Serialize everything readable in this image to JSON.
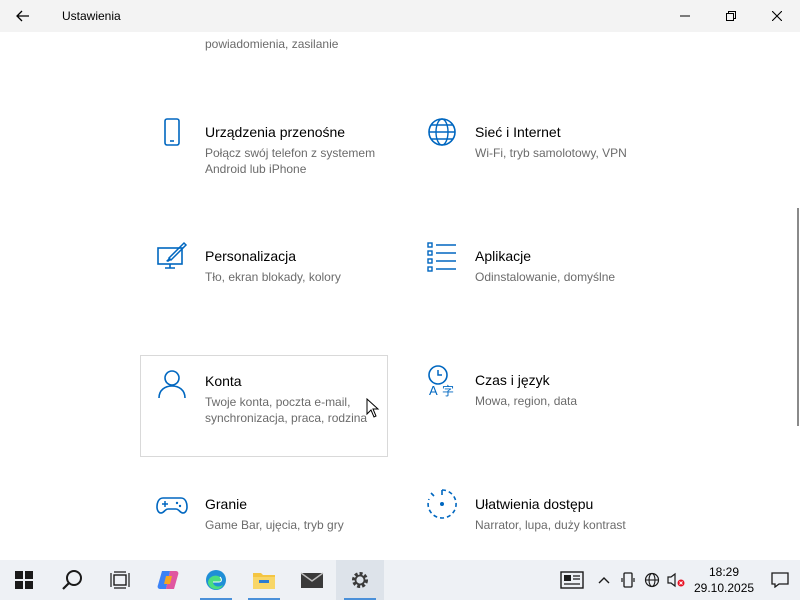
{
  "window": {
    "title": "Ustawienia"
  },
  "partial": {
    "line1": "powiadomienia, zasilanie",
    "top_left": "· · · · · · · · · · · ·",
    "top_right": "· · · · · · · · · · · · · · ·"
  },
  "tiles": [
    {
      "name": "Urządzenia przenośne",
      "desc": "Połącz swój telefon z systemem Android lub iPhone",
      "icon": "phone-icon"
    },
    {
      "name": "Sieć i Internet",
      "desc": "Wi-Fi, tryb samolotowy, VPN",
      "icon": "globe-icon"
    },
    {
      "name": "Personalizacja",
      "desc": "Tło, ekran blokady, kolory",
      "icon": "personalization-icon"
    },
    {
      "name": "Aplikacje",
      "desc": "Odinstalowanie, domyślne",
      "icon": "apps-icon"
    },
    {
      "name": "Konta",
      "desc": "Twoje konta, poczta e-mail, synchronizacja, praca, rodzina",
      "icon": "person-icon"
    },
    {
      "name": "Czas i język",
      "desc": "Mowa, region, data",
      "icon": "time-language-icon"
    },
    {
      "name": "Granie",
      "desc": "Game Bar, ujęcia, tryb gry",
      "icon": "gamepad-icon"
    },
    {
      "name": "Ułatwienia dostępu",
      "desc": "Narrator, lupa, duży kontrast",
      "icon": "accessibility-icon"
    }
  ],
  "taskbar": {
    "time": "18:29",
    "date": "29.10.2025"
  },
  "colors": {
    "accent": "#0067c0",
    "titlebar": "#f3f3f3",
    "taskbar": "#eef1f5",
    "secondary_text": "#6b6b6b"
  }
}
